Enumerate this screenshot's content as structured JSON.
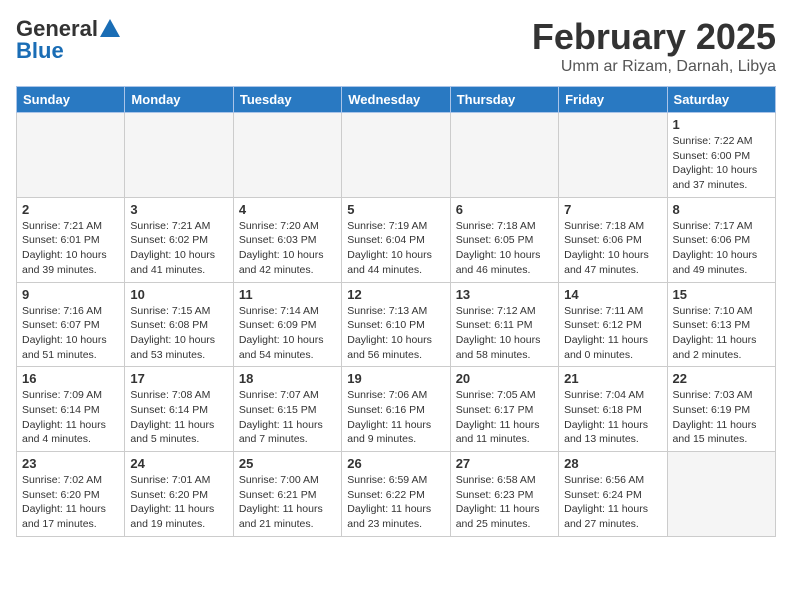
{
  "header": {
    "logo_general": "General",
    "logo_blue": "Blue",
    "title": "February 2025",
    "subtitle": "Umm ar Rizam, Darnah, Libya"
  },
  "days_of_week": [
    "Sunday",
    "Monday",
    "Tuesday",
    "Wednesday",
    "Thursday",
    "Friday",
    "Saturday"
  ],
  "weeks": [
    [
      {
        "day": null,
        "info": null
      },
      {
        "day": null,
        "info": null
      },
      {
        "day": null,
        "info": null
      },
      {
        "day": null,
        "info": null
      },
      {
        "day": null,
        "info": null
      },
      {
        "day": null,
        "info": null
      },
      {
        "day": "1",
        "info": "Sunrise: 7:22 AM\nSunset: 6:00 PM\nDaylight: 10 hours and 37 minutes."
      }
    ],
    [
      {
        "day": "2",
        "info": "Sunrise: 7:21 AM\nSunset: 6:01 PM\nDaylight: 10 hours and 39 minutes."
      },
      {
        "day": "3",
        "info": "Sunrise: 7:21 AM\nSunset: 6:02 PM\nDaylight: 10 hours and 41 minutes."
      },
      {
        "day": "4",
        "info": "Sunrise: 7:20 AM\nSunset: 6:03 PM\nDaylight: 10 hours and 42 minutes."
      },
      {
        "day": "5",
        "info": "Sunrise: 7:19 AM\nSunset: 6:04 PM\nDaylight: 10 hours and 44 minutes."
      },
      {
        "day": "6",
        "info": "Sunrise: 7:18 AM\nSunset: 6:05 PM\nDaylight: 10 hours and 46 minutes."
      },
      {
        "day": "7",
        "info": "Sunrise: 7:18 AM\nSunset: 6:06 PM\nDaylight: 10 hours and 47 minutes."
      },
      {
        "day": "8",
        "info": "Sunrise: 7:17 AM\nSunset: 6:06 PM\nDaylight: 10 hours and 49 minutes."
      }
    ],
    [
      {
        "day": "9",
        "info": "Sunrise: 7:16 AM\nSunset: 6:07 PM\nDaylight: 10 hours and 51 minutes."
      },
      {
        "day": "10",
        "info": "Sunrise: 7:15 AM\nSunset: 6:08 PM\nDaylight: 10 hours and 53 minutes."
      },
      {
        "day": "11",
        "info": "Sunrise: 7:14 AM\nSunset: 6:09 PM\nDaylight: 10 hours and 54 minutes."
      },
      {
        "day": "12",
        "info": "Sunrise: 7:13 AM\nSunset: 6:10 PM\nDaylight: 10 hours and 56 minutes."
      },
      {
        "day": "13",
        "info": "Sunrise: 7:12 AM\nSunset: 6:11 PM\nDaylight: 10 hours and 58 minutes."
      },
      {
        "day": "14",
        "info": "Sunrise: 7:11 AM\nSunset: 6:12 PM\nDaylight: 11 hours and 0 minutes."
      },
      {
        "day": "15",
        "info": "Sunrise: 7:10 AM\nSunset: 6:13 PM\nDaylight: 11 hours and 2 minutes."
      }
    ],
    [
      {
        "day": "16",
        "info": "Sunrise: 7:09 AM\nSunset: 6:14 PM\nDaylight: 11 hours and 4 minutes."
      },
      {
        "day": "17",
        "info": "Sunrise: 7:08 AM\nSunset: 6:14 PM\nDaylight: 11 hours and 5 minutes."
      },
      {
        "day": "18",
        "info": "Sunrise: 7:07 AM\nSunset: 6:15 PM\nDaylight: 11 hours and 7 minutes."
      },
      {
        "day": "19",
        "info": "Sunrise: 7:06 AM\nSunset: 6:16 PM\nDaylight: 11 hours and 9 minutes."
      },
      {
        "day": "20",
        "info": "Sunrise: 7:05 AM\nSunset: 6:17 PM\nDaylight: 11 hours and 11 minutes."
      },
      {
        "day": "21",
        "info": "Sunrise: 7:04 AM\nSunset: 6:18 PM\nDaylight: 11 hours and 13 minutes."
      },
      {
        "day": "22",
        "info": "Sunrise: 7:03 AM\nSunset: 6:19 PM\nDaylight: 11 hours and 15 minutes."
      }
    ],
    [
      {
        "day": "23",
        "info": "Sunrise: 7:02 AM\nSunset: 6:20 PM\nDaylight: 11 hours and 17 minutes."
      },
      {
        "day": "24",
        "info": "Sunrise: 7:01 AM\nSunset: 6:20 PM\nDaylight: 11 hours and 19 minutes."
      },
      {
        "day": "25",
        "info": "Sunrise: 7:00 AM\nSunset: 6:21 PM\nDaylight: 11 hours and 21 minutes."
      },
      {
        "day": "26",
        "info": "Sunrise: 6:59 AM\nSunset: 6:22 PM\nDaylight: 11 hours and 23 minutes."
      },
      {
        "day": "27",
        "info": "Sunrise: 6:58 AM\nSunset: 6:23 PM\nDaylight: 11 hours and 25 minutes."
      },
      {
        "day": "28",
        "info": "Sunrise: 6:56 AM\nSunset: 6:24 PM\nDaylight: 11 hours and 27 minutes."
      },
      {
        "day": null,
        "info": null
      }
    ]
  ]
}
